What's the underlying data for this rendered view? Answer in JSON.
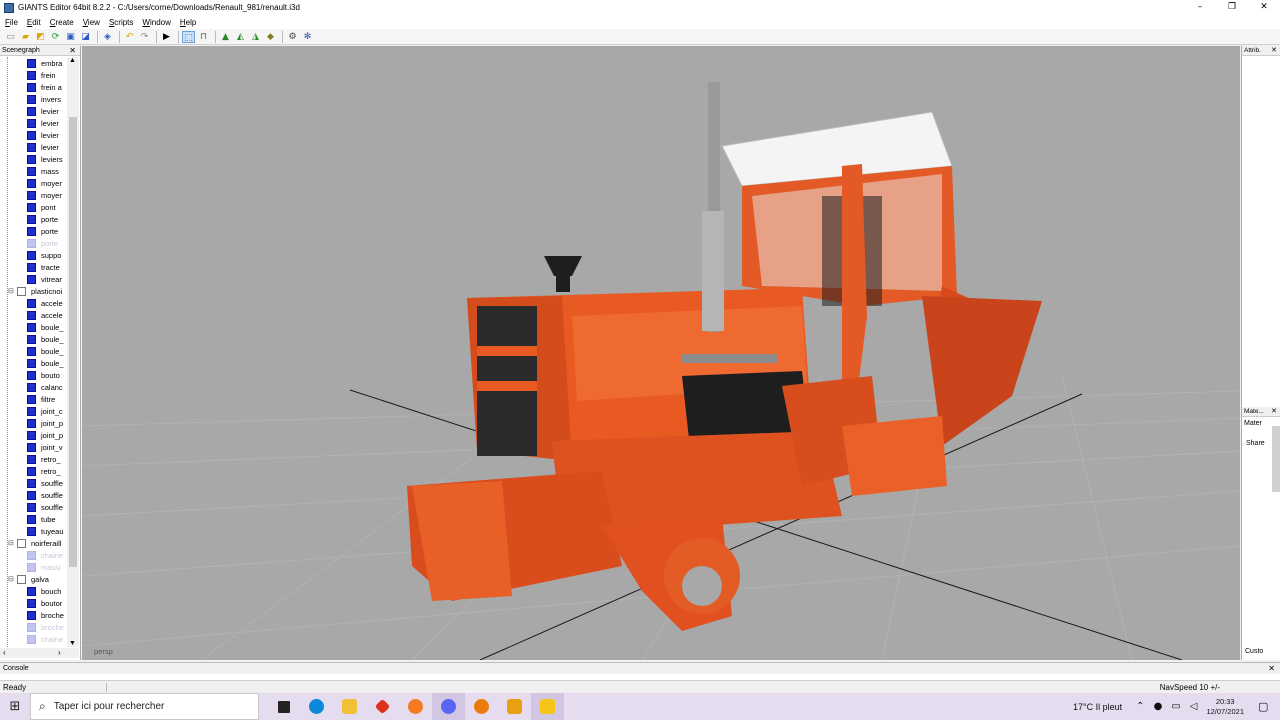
{
  "window": {
    "title": "GIANTS Editor 64bit 8.2.2 - C:/Users/corne/Downloads/Renault_981/renault.i3d",
    "minimize": "–",
    "maximize": "❐",
    "close": "✕"
  },
  "menu": [
    "File",
    "Edit",
    "Create",
    "View",
    "Scripts",
    "Window",
    "Help"
  ],
  "scenegraph": {
    "title": "Scenegraph",
    "close": "✕",
    "nodes": [
      {
        "label": "embra",
        "kind": "shape"
      },
      {
        "label": "frein",
        "kind": "shape"
      },
      {
        "label": "frein a",
        "kind": "shape"
      },
      {
        "label": "invers",
        "kind": "shape"
      },
      {
        "label": "levier",
        "kind": "shape"
      },
      {
        "label": "levier",
        "kind": "shape"
      },
      {
        "label": "levier",
        "kind": "shape"
      },
      {
        "label": "levier",
        "kind": "shape"
      },
      {
        "label": "leviers",
        "kind": "shape"
      },
      {
        "label": "mass",
        "kind": "shape"
      },
      {
        "label": "moyer",
        "kind": "shape"
      },
      {
        "label": "moyer",
        "kind": "shape"
      },
      {
        "label": "pont",
        "kind": "shape"
      },
      {
        "label": "porte",
        "kind": "shape"
      },
      {
        "label": "porte",
        "kind": "shape"
      },
      {
        "label": "porte",
        "kind": "dim"
      },
      {
        "label": "suppo",
        "kind": "shape"
      },
      {
        "label": "tracte",
        "kind": "shape"
      },
      {
        "label": "vitrear",
        "kind": "shape"
      },
      {
        "label": "plasticnoi",
        "kind": "group"
      },
      {
        "label": "accele",
        "kind": "shape"
      },
      {
        "label": "accele",
        "kind": "shape"
      },
      {
        "label": "boule_",
        "kind": "shape"
      },
      {
        "label": "boule_",
        "kind": "shape"
      },
      {
        "label": "boule_",
        "kind": "shape"
      },
      {
        "label": "boule_",
        "kind": "shape"
      },
      {
        "label": "bouto",
        "kind": "shape"
      },
      {
        "label": "calanc",
        "kind": "shape"
      },
      {
        "label": "filtre",
        "kind": "shape"
      },
      {
        "label": "joint_c",
        "kind": "shape"
      },
      {
        "label": "joint_p",
        "kind": "shape"
      },
      {
        "label": "joint_p",
        "kind": "shape"
      },
      {
        "label": "joint_v",
        "kind": "shape"
      },
      {
        "label": "retro_",
        "kind": "shape"
      },
      {
        "label": "retro_",
        "kind": "shape"
      },
      {
        "label": "souffle",
        "kind": "shape"
      },
      {
        "label": "souffle",
        "kind": "shape"
      },
      {
        "label": "souffle",
        "kind": "shape"
      },
      {
        "label": "tube",
        "kind": "shape"
      },
      {
        "label": "tuyeau",
        "kind": "shape"
      },
      {
        "label": "noirferaill",
        "kind": "group"
      },
      {
        "label": "chaine",
        "kind": "dim"
      },
      {
        "label": "massi",
        "kind": "dim"
      },
      {
        "label": "galva",
        "kind": "group"
      },
      {
        "label": "bouch",
        "kind": "shape"
      },
      {
        "label": "boutor",
        "kind": "shape"
      },
      {
        "label": "broche",
        "kind": "shape"
      },
      {
        "label": "broche",
        "kind": "dim"
      },
      {
        "label": "chaine",
        "kind": "dim"
      }
    ]
  },
  "viewport": {
    "camera": "persp"
  },
  "attributes": {
    "title": "Attrib.",
    "close": "✕"
  },
  "material": {
    "title": "Mate...",
    "close": "✕",
    "tab": "Mater",
    "shared": "Share",
    "custom": "Custo"
  },
  "console": {
    "title": "Console",
    "close": "✕"
  },
  "status": {
    "text": "Ready",
    "navspeed": "NavSpeed 10 +/-"
  },
  "taskbar": {
    "search_placeholder": "Taper ici pour rechercher",
    "apps": [
      {
        "name": "task-view",
        "color": "#222222"
      },
      {
        "name": "skype",
        "color": "#0a8ad8"
      },
      {
        "name": "file-explorer",
        "color": "#f2c037"
      },
      {
        "name": "red-app",
        "color": "#e0301e"
      },
      {
        "name": "firefox",
        "color": "#f47a20"
      },
      {
        "name": "discord",
        "color": "#5865f2"
      },
      {
        "name": "blender",
        "color": "#e87d0d"
      },
      {
        "name": "farming-simulator",
        "color": "#e8a010"
      },
      {
        "name": "giants-editor",
        "color": "#f5c518"
      }
    ],
    "weather": "17°C  Il pleut",
    "time": "20:33",
    "date": "12/07/2021"
  },
  "colors": {
    "tractor_orange": "#e0501f",
    "viewport_bg": "#a8a8a8",
    "taskbar_bg": "#e6dcef",
    "node_blue": "#1f2fd0"
  }
}
